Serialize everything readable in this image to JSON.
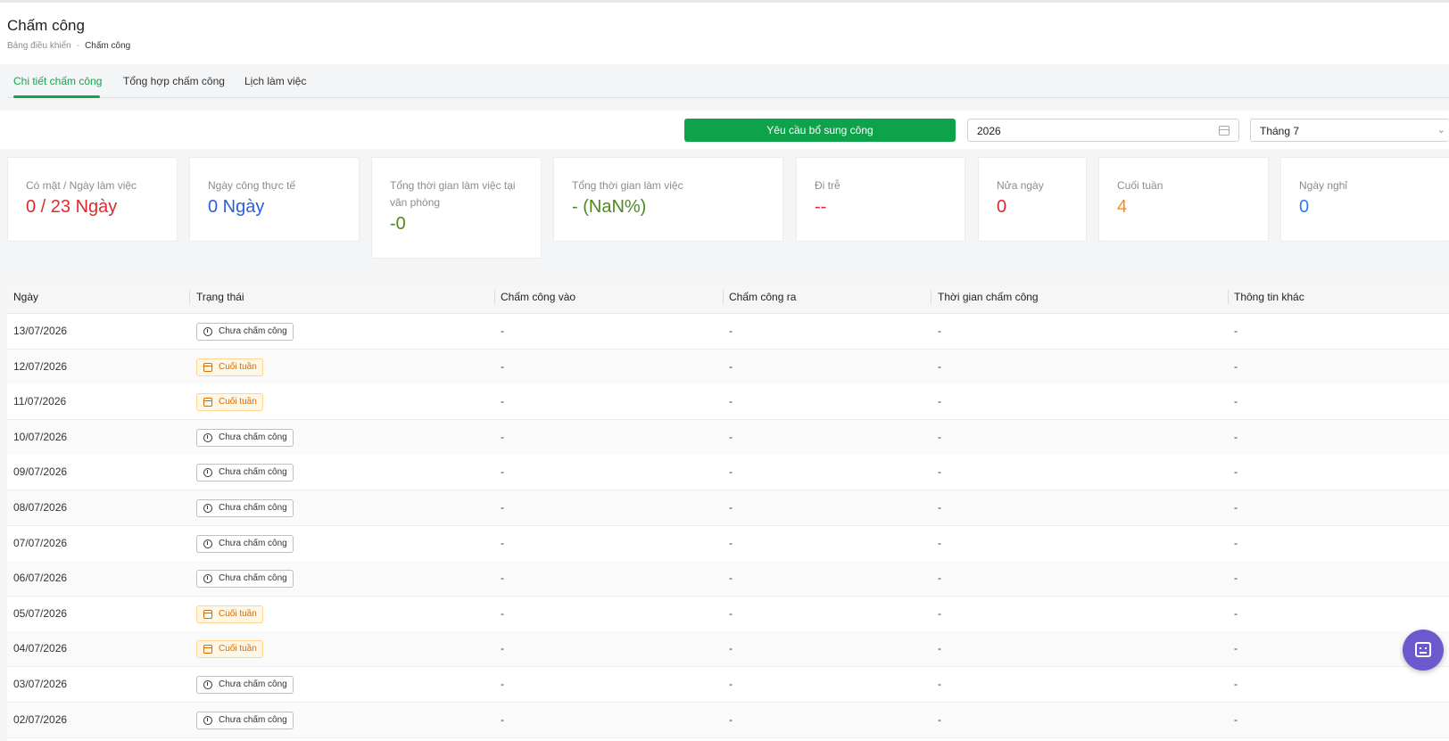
{
  "page": {
    "title": "Chấm công",
    "breadcrumb": [
      "Bảng điều khiển",
      "-",
      "Chấm công"
    ]
  },
  "tabs": [
    {
      "label": "Chi tiết chấm công",
      "active": true
    },
    {
      "label": "Tổng hợp chấm công",
      "active": false
    },
    {
      "label": "Lịch làm việc",
      "active": false
    }
  ],
  "toolbar": {
    "request_button": "Yêu cầu bổ sung công",
    "year_value": "2026",
    "month_value": "Tháng 7"
  },
  "stats": [
    {
      "label": "Có mặt / Ngày làm việc",
      "value": "0 / 23 Ngày",
      "color": "#e0282e"
    },
    {
      "label": "Ngày công thực tế",
      "value": "0 Ngày",
      "color": "#2b5fd9"
    },
    {
      "label": "Tổng thời gian làm việc tại văn phòng",
      "value": "-0",
      "color": "#4d8a1c"
    },
    {
      "label": "Tổng thời gian làm việc",
      "value": "- (NaN%)",
      "color": "#4d8a1c"
    },
    {
      "label": "Đi trễ",
      "value": "--",
      "color": "#e0282e"
    },
    {
      "label": "Nửa ngày",
      "value": "0",
      "color": "#e0282e"
    },
    {
      "label": "Cuối tuần",
      "value": "4",
      "color": "#f28c28"
    },
    {
      "label": "Ngày nghỉ",
      "value": "0",
      "color": "#2b7cf0"
    }
  ],
  "table": {
    "headers": [
      "Ngày",
      "Trạng thái",
      "Chấm công vào",
      "Chấm công ra",
      "Thời gian chấm công",
      "Thông tin khác"
    ],
    "rows": [
      {
        "date": "13/07/2026",
        "status": "Chưa chấm công",
        "type": "pending",
        "in": "-",
        "out": "-",
        "time": "-",
        "other": "-"
      },
      {
        "date": "12/07/2026",
        "status": "Cuối tuần",
        "type": "weekend",
        "in": "-",
        "out": "-",
        "time": "-",
        "other": "-"
      },
      {
        "date": "11/07/2026",
        "status": "Cuối tuần",
        "type": "weekend",
        "in": "-",
        "out": "-",
        "time": "-",
        "other": "-"
      },
      {
        "date": "10/07/2026",
        "status": "Chưa chấm công",
        "type": "pending",
        "in": "-",
        "out": "-",
        "time": "-",
        "other": "-"
      },
      {
        "date": "09/07/2026",
        "status": "Chưa chấm công",
        "type": "pending",
        "in": "-",
        "out": "-",
        "time": "-",
        "other": "-"
      },
      {
        "date": "08/07/2026",
        "status": "Chưa chấm công",
        "type": "pending",
        "in": "-",
        "out": "-",
        "time": "-",
        "other": "-"
      },
      {
        "date": "07/07/2026",
        "status": "Chưa chấm công",
        "type": "pending",
        "in": "-",
        "out": "-",
        "time": "-",
        "other": "-"
      },
      {
        "date": "06/07/2026",
        "status": "Chưa chấm công",
        "type": "pending",
        "in": "-",
        "out": "-",
        "time": "-",
        "other": "-"
      },
      {
        "date": "05/07/2026",
        "status": "Cuối tuần",
        "type": "weekend",
        "in": "-",
        "out": "-",
        "time": "-",
        "other": "-"
      },
      {
        "date": "04/07/2026",
        "status": "Cuối tuần",
        "type": "weekend",
        "in": "-",
        "out": "-",
        "time": "-",
        "other": "-"
      },
      {
        "date": "03/07/2026",
        "status": "Chưa chấm công",
        "type": "pending",
        "in": "-",
        "out": "-",
        "time": "-",
        "other": "-"
      },
      {
        "date": "02/07/2026",
        "status": "Chưa chấm công",
        "type": "pending",
        "in": "-",
        "out": "-",
        "time": "-",
        "other": "-"
      }
    ]
  },
  "icons": {
    "pending": "clock-icon",
    "weekend": "calendar-icon",
    "year_field": "calendar-icon",
    "month_field": "chevron-down-icon",
    "chat": "chatbot-icon"
  }
}
